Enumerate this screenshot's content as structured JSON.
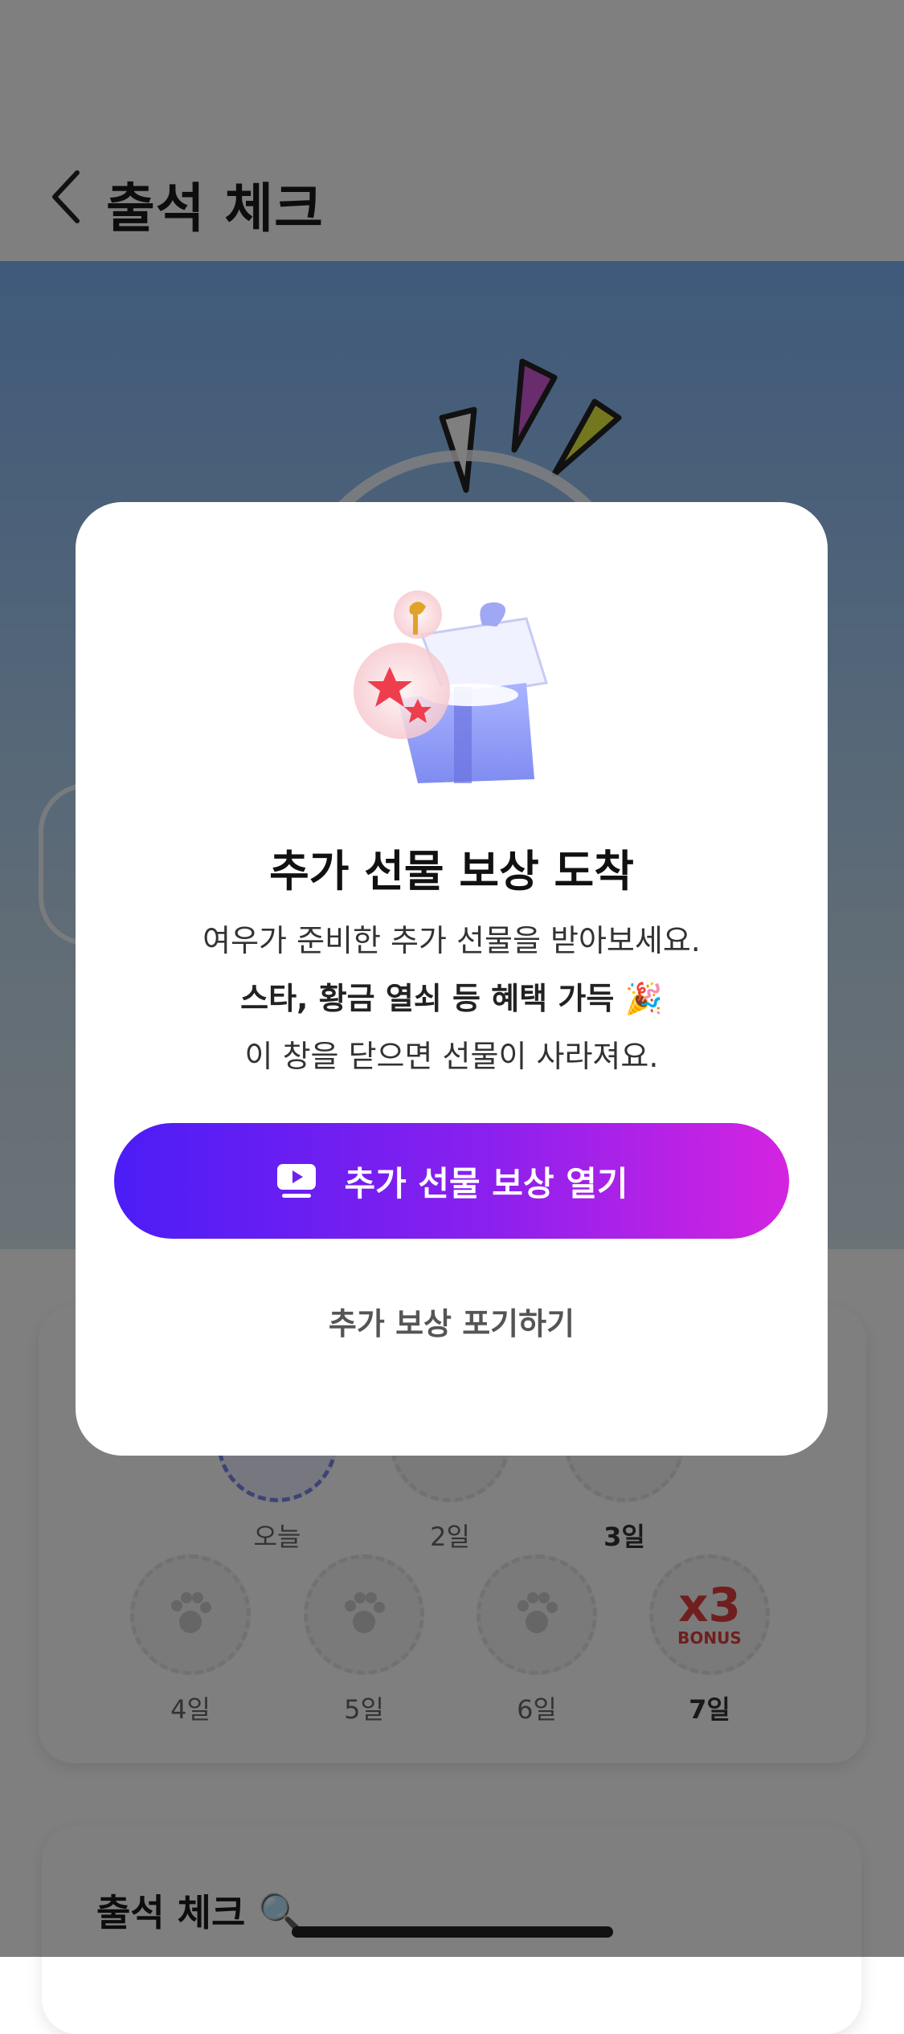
{
  "header": {
    "title": "출석 체크"
  },
  "attendance": {
    "row1": [
      {
        "label": "오늘"
      },
      {
        "label": "2일"
      },
      {
        "label": "3일"
      }
    ],
    "row2": [
      {
        "label": "4일"
      },
      {
        "label": "5일"
      },
      {
        "label": "6일"
      },
      {
        "label": "7일",
        "bonus_multiplier": "x3",
        "bonus_text": "BONUS"
      }
    ]
  },
  "section2": {
    "title": "출석 체크 🔍"
  },
  "modal": {
    "title": "추가 선물 보상 도착",
    "desc_line1": "여우가 준비한 추가 선물을 받아보세요.",
    "desc_line2": "스타, 황금 열쇠 등 혜택 가득 🎉",
    "desc_line3": "이 창을 닫으면 선물이 사라져요.",
    "cta_label": "추가 선물 보상 열기",
    "cta_icon": "video-play-icon",
    "decline_label": "추가 보상 포기하기"
  },
  "colors": {
    "cta_gradient_start": "#4b1df6",
    "cta_gradient_end": "#d424e0",
    "bonus_red": "#e03c3c"
  }
}
